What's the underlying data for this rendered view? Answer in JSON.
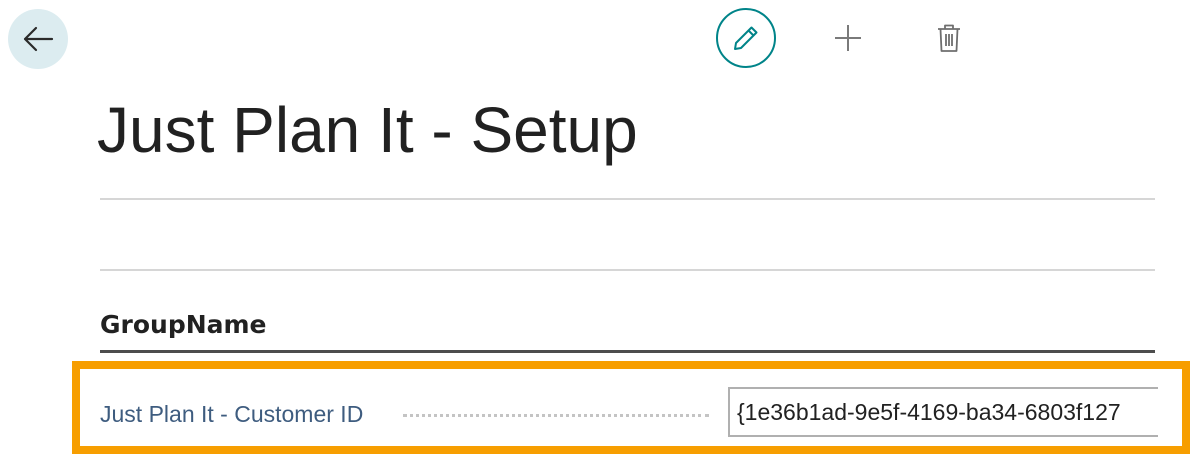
{
  "header": {
    "icons": {
      "back": "arrow-left-icon",
      "edit": "pencil-icon",
      "new": "plus-icon",
      "delete": "trash-icon"
    }
  },
  "page": {
    "title": "Just Plan It - Setup"
  },
  "group": {
    "name": "GroupName",
    "fields": [
      {
        "label": "Just Plan It - Customer ID",
        "value": "{1e36b1ad-9e5f-4169-ba34-6803f127"
      }
    ]
  },
  "colors": {
    "accent": "#008489",
    "back_button_bg": "#dcecf0",
    "highlight": "#f79e00",
    "field_label": "#3e5c7f"
  }
}
